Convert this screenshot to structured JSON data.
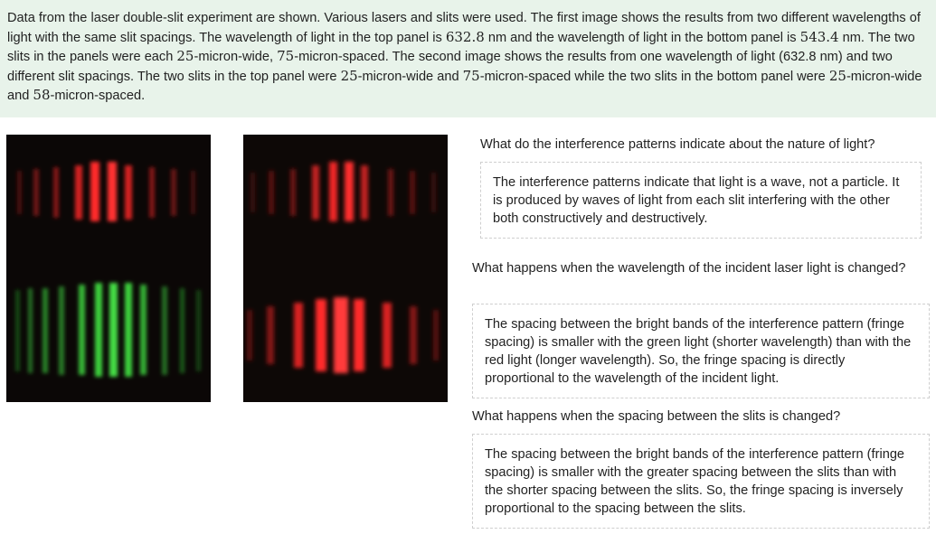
{
  "intro": {
    "s1": "Data from the laser double-slit experiment are shown. Various lasers and slits were used. The first image shows the results from two different wavelengths of light with the same slit spacings. The wavelength of light in the top panel is ",
    "v1": "632.8",
    "s2": " nm and the wavelength of light in the bottom panel is ",
    "v2": "543.4",
    "s3": " nm. The two slits in the panels were each ",
    "v3": "25",
    "s4": "-micron-wide, ",
    "v4": "75",
    "s5": "-micron-spaced. The second image shows the results from one wavelength of light (632.8 nm) and two different slit spacings. The two slits in the top panel were ",
    "v5": "25",
    "s6": "-micron-wide and ",
    "v6": "75",
    "s7": "-micron-spaced while the two slits in the bottom panel were ",
    "v7": "25",
    "s8": "-micron-wide and ",
    "v8": "58",
    "s9": "-micron-spaced."
  },
  "colors": {
    "background": "#ffffff",
    "intro_bg": "#e8f3ea",
    "red_fringe": "#ff2a2a",
    "green_fringe": "#3ccf3c",
    "dashed_border": "#cfcfcf"
  },
  "qa": [
    {
      "question": "What do the interference patterns indicate about the nature of light?",
      "answer": "The interference patterns indicate that light is a wave, not a particle. It is produced by waves of light from each slit interfering with the other both constructively and destructively."
    },
    {
      "question": "What happens when the wavelength of the incident laser light is changed?",
      "answer": "The spacing between the bright bands of the interference pattern (fringe spacing) is smaller with the green light (shorter wavelength) than with the red light (longer wavelength). So, the fringe spacing is directly proportional to the wavelength of the incident light."
    },
    {
      "question": "What happens when the spacing between the slits is changed?",
      "answer": "The spacing between the bright bands of the interference pattern (fringe spacing) is smaller with the greater spacing between the slits than with the shorter spacing between the slits. So, the fringe spacing is inversely proportional to the spacing between the slits."
    }
  ]
}
